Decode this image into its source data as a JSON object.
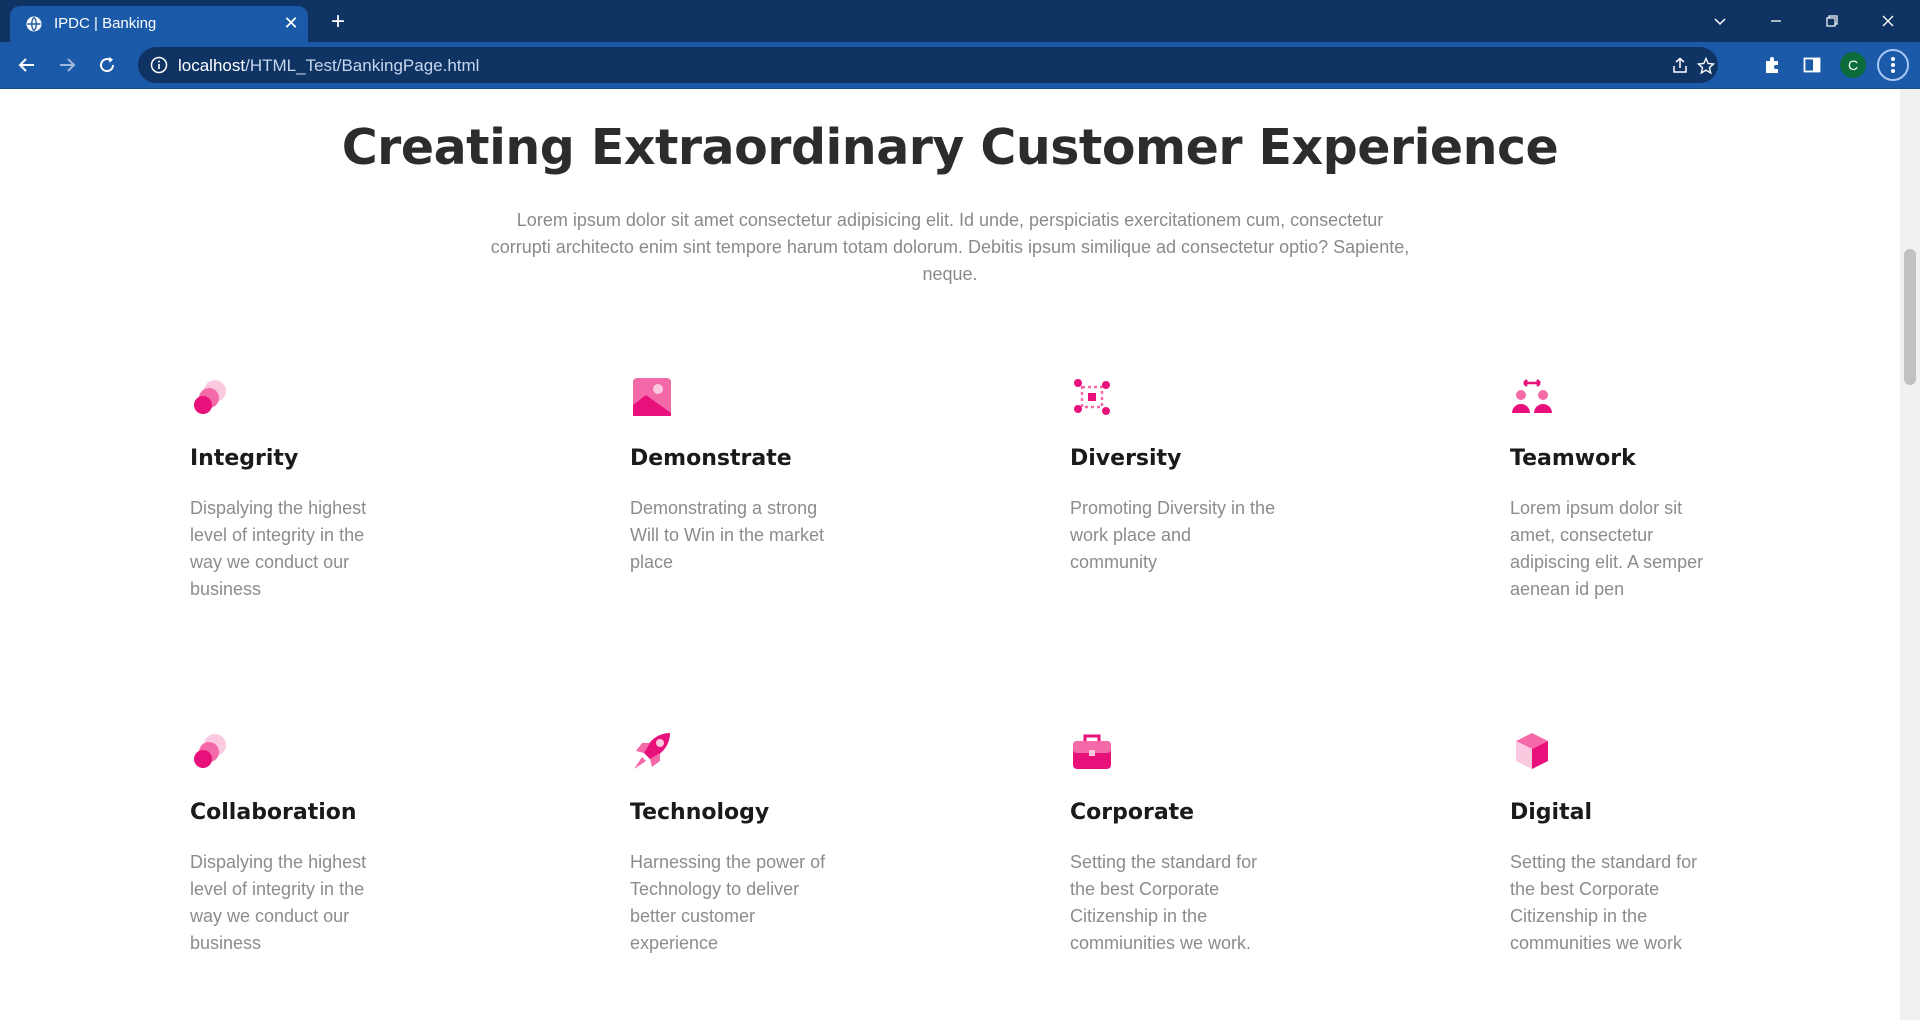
{
  "browser": {
    "tab_title": "IPDC | Banking",
    "url_host": "localhost",
    "url_path": "/HTML_Test/BankingPage.html",
    "profile_initial": "C"
  },
  "page": {
    "heading": "Creating Extraordinary Customer Experience",
    "intro": "Lorem ipsum dolor sit amet consectetur adipisicing elit. Id unde, perspiciatis exercitationem cum, consectetur corrupti architecto enim sint tempore harum totam dolorum. Debitis ipsum similique ad consectetur optio? Sapiente, neque.",
    "accent_color": "#e8107a",
    "cards": [
      {
        "icon": "dots-icon",
        "title": "Integrity",
        "text": "Dispalying the highest level of integrity in the way we conduct our business"
      },
      {
        "icon": "image-icon",
        "title": "Demonstrate",
        "text": "Demonstrating a strong Will to Win in the market place"
      },
      {
        "icon": "network-icon",
        "title": "Diversity",
        "text": "Promoting Diversity in the work place and community"
      },
      {
        "icon": "teamwork-icon",
        "title": "Teamwork",
        "text": "Lorem ipsum dolor sit amet, consectetur adipiscing elit. A semper aenean id pen"
      },
      {
        "icon": "dots-icon",
        "title": "Collaboration",
        "text": "Dispalying the highest level of integrity in the way we conduct our business"
      },
      {
        "icon": "rocket-icon",
        "title": "Technology",
        "text": "Harnessing the power of Technology to deliver better customer experience"
      },
      {
        "icon": "briefcase-icon",
        "title": "Corporate",
        "text": "Setting the standard for the best Corporate Citizenship in the commiunities we work."
      },
      {
        "icon": "cube-icon",
        "title": "Digital",
        "text": "Setting the standard for the best Corporate Citizenship in the communities we work"
      }
    ]
  }
}
